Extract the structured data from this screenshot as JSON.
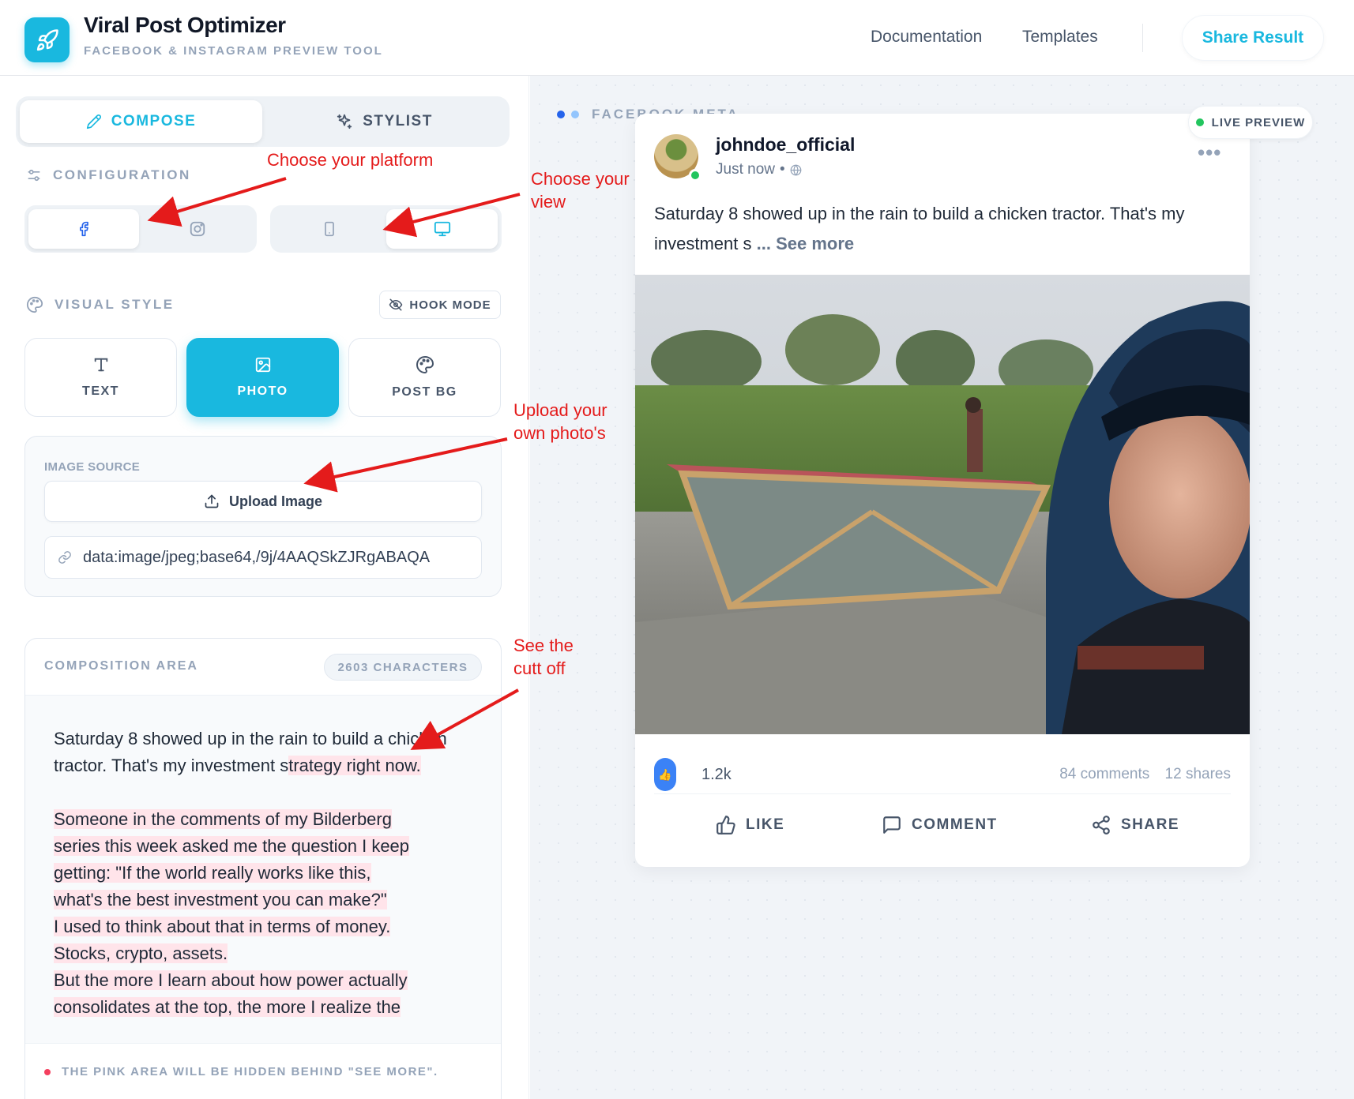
{
  "header": {
    "title": "Viral Post Optimizer",
    "subtitle": "FACEBOOK & INSTAGRAM PREVIEW TOOL",
    "nav": [
      "Documentation",
      "Templates"
    ],
    "share_label": "Share Result"
  },
  "tabs": {
    "compose": "COMPOSE",
    "stylist": "STYLIST"
  },
  "configuration": {
    "label": "CONFIGURATION",
    "platform": "facebook",
    "view": "desktop"
  },
  "visual_style": {
    "label": "VISUAL STYLE",
    "hook_mode": "HOOK MODE",
    "options": [
      "TEXT",
      "PHOTO",
      "POST BG"
    ],
    "selected": "PHOTO"
  },
  "image_source": {
    "label": "IMAGE SOURCE",
    "upload_label": "Upload Image",
    "url_value": "data:image/jpeg;base64,/9j/4AAQSkZJRgABAQA"
  },
  "composition": {
    "title": "COMPOSITION AREA",
    "char_count": "2603 CHARACTERS",
    "visible_lead": "Saturday 8 showed up in the rain to build a chicken tractor. That's my investment s",
    "hidden_lead": "trategy right now.",
    "p2_lines": [
      "Someone in the comments of my Bilderberg",
      "series this week asked me the question I keep",
      "getting: \"If the world really works like this,",
      "what's the best investment you can make?\"",
      "I used to think about that in terms of money.",
      "Stocks, crypto, assets.",
      "But the more I learn about how power actually",
      "consolidates at the top, the more I realize the"
    ],
    "footer_note": "THE PINK AREA WILL BE HIDDEN BEHIND \"SEE MORE\"."
  },
  "preview": {
    "platform_label": "FACEBOOK META",
    "live_label": "LIVE PREVIEW",
    "username": "johndoe_official",
    "time": "Just now",
    "text": "Saturday 8 showed up in the rain to build a chicken tractor. That's my investment s",
    "see_more": "... See more",
    "reactions": "1.2k",
    "comments": "84 comments",
    "shares": "12 shares",
    "actions": {
      "like": "LIKE",
      "comment": "COMMENT",
      "share": "SHARE"
    }
  },
  "annotations": {
    "platform": "Choose your platform",
    "view_1": "Choose your",
    "view_2": "view",
    "upload_1": "Upload your",
    "upload_2": "own photo's",
    "cutoff_1": "See the",
    "cutoff_2": "cutt off"
  },
  "colors": {
    "accent": "#19b8df",
    "annotation": "#e41b1b",
    "highlight": "#ffe4ea"
  }
}
